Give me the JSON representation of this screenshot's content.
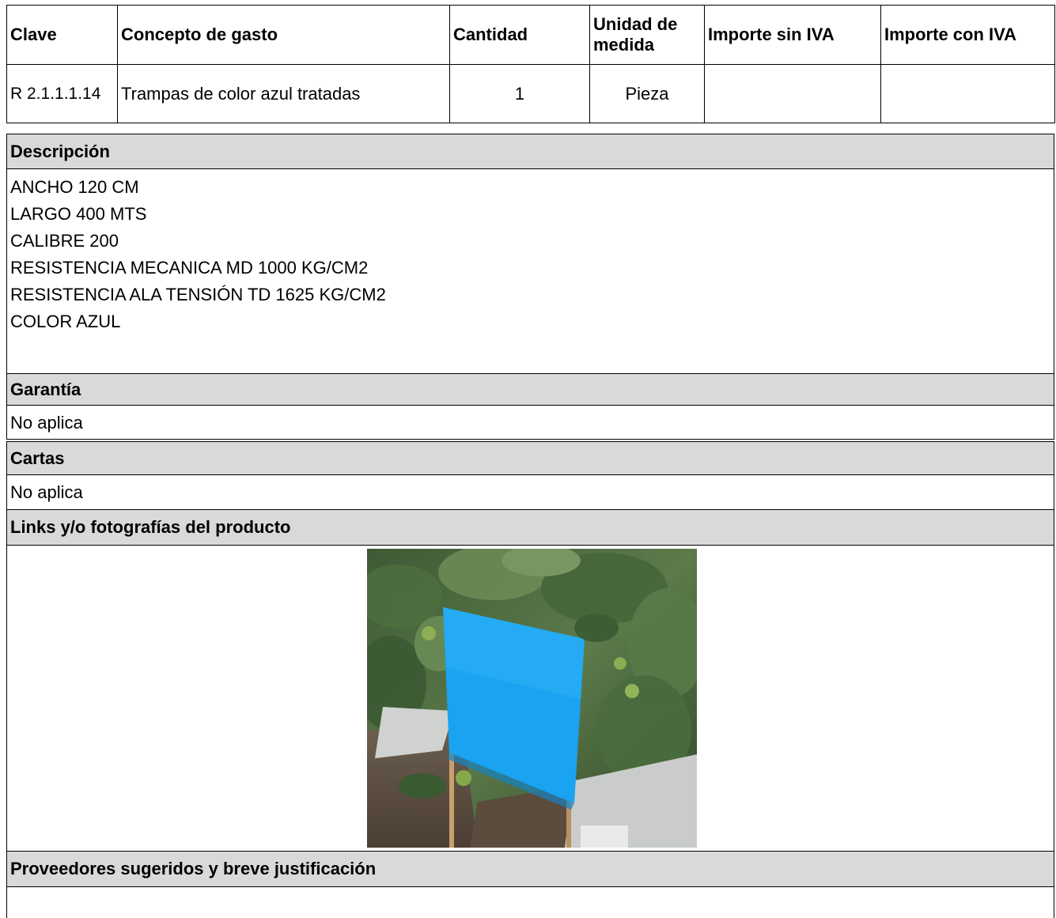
{
  "table": {
    "headers": [
      "Clave",
      "Concepto de gasto",
      "Cantidad",
      "Unidad de medida",
      "Importe sin IVA",
      "Importe con IVA"
    ],
    "row": {
      "clave": "R 2.1.1.1.14",
      "concepto": "Trampas de color azul tratadas",
      "cantidad": "1",
      "unidad": "Pieza",
      "importe_sin_iva": "",
      "importe_con_iva": ""
    }
  },
  "descripcion": {
    "title": "Descripción",
    "lines": [
      "ANCHO 120 CM",
      "LARGO 400 MTS",
      "CALIBRE 200",
      "RESISTENCIA MECANICA MD 1000 KG/CM2",
      "RESISTENCIA ALA TENSIÓN TD 1625 KG/CM2",
      "COLOR AZUL"
    ]
  },
  "garantia": {
    "title": "Garantía",
    "value": "No aplica"
  },
  "cartas": {
    "title": "Cartas",
    "value": "No aplica"
  },
  "links": {
    "title": "Links y/o fotografías del producto"
  },
  "proveedores": {
    "title": "Proveedores sugeridos y breve justificación",
    "value": ""
  },
  "colors": {
    "section_bg": "#d9d9d9",
    "trap_blue": "#1aa3f0",
    "border": "#000000"
  }
}
